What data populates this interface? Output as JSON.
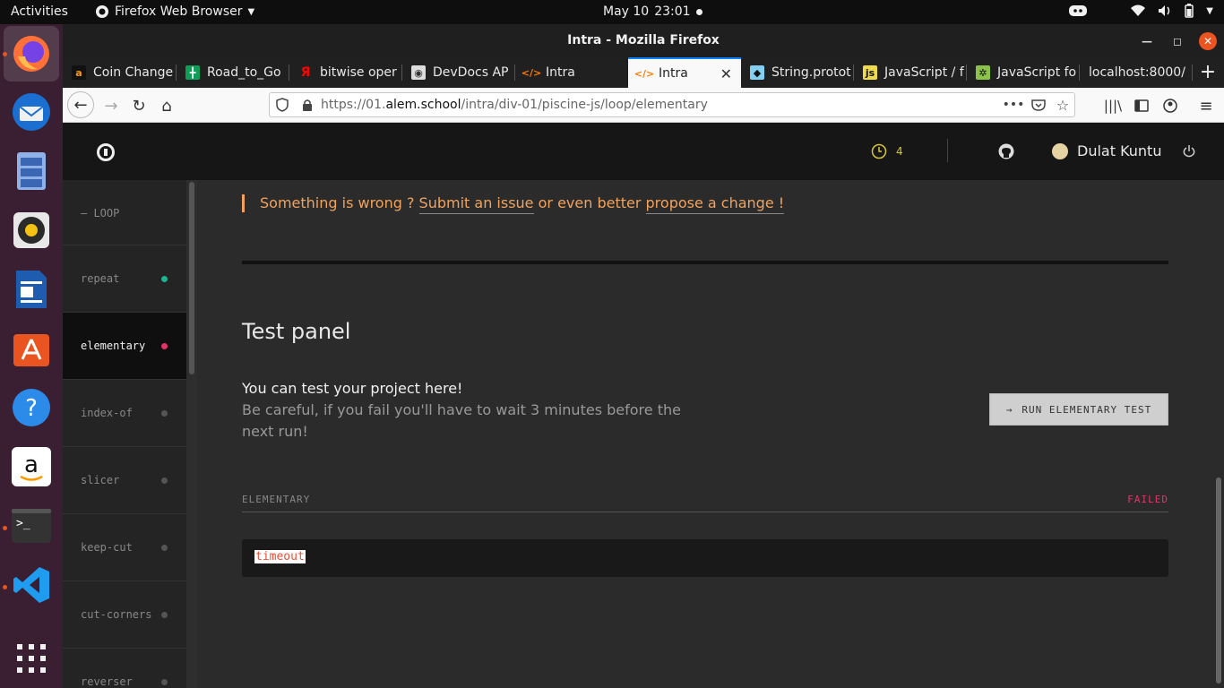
{
  "topbar": {
    "activities": "Activities",
    "app_name": "Firefox Web Browser",
    "date": "May 10",
    "time": "23:01"
  },
  "window": {
    "title": "Intra - Mozilla Firefox"
  },
  "tabs": [
    {
      "label": "Coin Change",
      "icon": "amazon-icon",
      "color": "#ff9900"
    },
    {
      "label": "Road_to_Go",
      "icon": "sheets-icon",
      "color": "#0f9d58"
    },
    {
      "label": "bitwise oper",
      "icon": "yandex-icon",
      "color": "#ff0000"
    },
    {
      "label": "DevDocs AP",
      "icon": "devdocs-icon",
      "color": "#dddddd"
    },
    {
      "label": "Intra",
      "icon": "code-icon",
      "color": "#ff7a00"
    },
    {
      "label": "Intra",
      "icon": "code-icon",
      "color": "#ff7a00"
    },
    {
      "label": "String.protot",
      "icon": "mdn-icon",
      "color": "#83d0f2"
    },
    {
      "label": "JavaScript / f",
      "icon": "js-icon",
      "color": "#f0db4f"
    },
    {
      "label": "JavaScript fo",
      "icon": "codewars-icon",
      "color": "#8bc34a"
    },
    {
      "label": "localhost:8000/",
      "icon": "",
      "color": ""
    }
  ],
  "url": {
    "prefix": "https://01.",
    "domain": "alem.school",
    "path": "/intra/div-01/piscine-js/loop/elementary"
  },
  "header": {
    "timer_count": "4",
    "user_name": "Dulat Kuntu"
  },
  "sidebar": {
    "section": "— LOOP",
    "items": [
      {
        "label": "repeat",
        "status": "#1bb58c"
      },
      {
        "label": "elementary",
        "status": "#e8306a"
      },
      {
        "label": "index-of",
        "status": "#555555"
      },
      {
        "label": "slicer",
        "status": "#555555"
      },
      {
        "label": "keep-cut",
        "status": "#555555"
      },
      {
        "label": "cut-corners",
        "status": "#555555"
      },
      {
        "label": "reverser",
        "status": "#555555"
      }
    ]
  },
  "notice": {
    "prefix": "Something is wrong ? ",
    "link1": "Submit an issue",
    "middle": " or even better ",
    "link2": "propose a change !"
  },
  "panel": {
    "title": "Test panel",
    "line1": "You can test your project here!",
    "line2": "Be careful, if you fail you'll have to wait 3 minutes before the next run!",
    "run_arrow": "→",
    "run_label": "RUN ELEMENTARY TEST",
    "result_name": "ELEMENTARY",
    "result_status": "FAILED",
    "output": "timeout"
  }
}
